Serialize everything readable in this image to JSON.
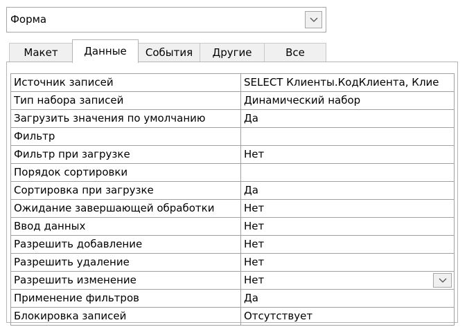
{
  "selector": {
    "value": "Форма"
  },
  "tabs": [
    {
      "label": "Макет"
    },
    {
      "label": "Данные"
    },
    {
      "label": "События"
    },
    {
      "label": "Другие"
    },
    {
      "label": "Все"
    }
  ],
  "active_tab": "Данные",
  "properties": [
    {
      "name": "Источник записей",
      "value": "SELECT Клиенты.КодКлиента, Клие"
    },
    {
      "name": "Тип набора записей",
      "value": "Динамический набор"
    },
    {
      "name": "Загрузить значения по умолчанию",
      "value": "Да"
    },
    {
      "name": "Фильтр",
      "value": ""
    },
    {
      "name": "Фильтр при загрузке",
      "value": "Нет"
    },
    {
      "name": "Порядок сортировки",
      "value": ""
    },
    {
      "name": "Сортировка при загрузке",
      "value": "Да"
    },
    {
      "name": "Ожидание завершающей обработки",
      "value": "Нет"
    },
    {
      "name": "Ввод данных",
      "value": "Нет"
    },
    {
      "name": "Разрешить добавление",
      "value": "Нет"
    },
    {
      "name": "Разрешить удаление",
      "value": "Нет"
    },
    {
      "name": "Разрешить изменение",
      "value": "Нет"
    },
    {
      "name": "Применение фильтров",
      "value": "Да"
    },
    {
      "name": "Блокировка записей",
      "value": "Отсутствует"
    }
  ]
}
